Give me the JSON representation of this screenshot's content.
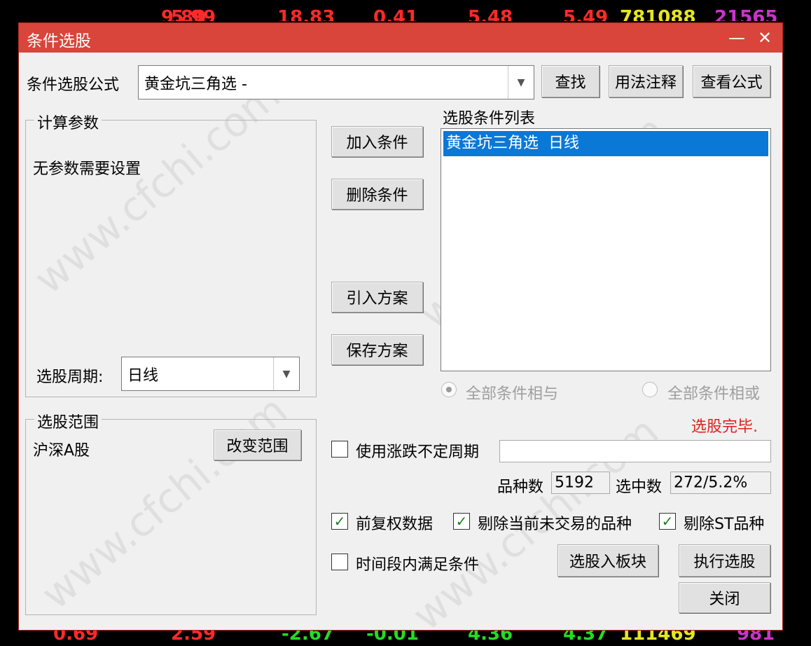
{
  "ticker_top": [
    {
      "text": "9.80",
      "color": "#ff2a2a"
    },
    {
      "text": "5.99",
      "color": "#ff2a2a"
    },
    {
      "text": "18.83",
      "color": "#ff2a2a"
    },
    {
      "text": "0.41",
      "color": "#ff2a2a"
    },
    {
      "text": "5.48",
      "color": "#ff2a2a"
    },
    {
      "text": "5.49",
      "color": "#ff2a2a"
    },
    {
      "text": "781088",
      "color": "#e6e61e"
    },
    {
      "text": "21565",
      "color": "#cc33cc"
    }
  ],
  "ticker_bottom": [
    {
      "text": "0.69",
      "color": "#ff2a2a"
    },
    {
      "text": "2.59",
      "color": "#ff2a2a"
    },
    {
      "text": "-2.67",
      "color": "#22dd22"
    },
    {
      "text": "-0.01",
      "color": "#22dd22"
    },
    {
      "text": "4.36",
      "color": "#22dd22"
    },
    {
      "text": "4.37",
      "color": "#22dd22"
    },
    {
      "text": "111469",
      "color": "#e6e61e"
    },
    {
      "text": "981",
      "color": "#cc33cc"
    }
  ],
  "window": {
    "title": "条件选股",
    "minimize_glyph": "—",
    "close_glyph": "✕"
  },
  "formula": {
    "label": "条件选股公式",
    "value": "黄金坑三角选 -",
    "find_button": "查找",
    "usage_button": "用法注释",
    "view_button": "查看公式"
  },
  "params": {
    "group_title": "计算参数",
    "message": "无参数需要设置",
    "period_label": "选股周期:",
    "period_value": "日线"
  },
  "range": {
    "group_title": "选股范围",
    "value": "沪深A股",
    "change_button": "改变范围"
  },
  "actions": {
    "add": "加入条件",
    "delete": "删除条件",
    "import": "引入方案",
    "save": "保存方案"
  },
  "conditions": {
    "title": "选股条件列表",
    "items": [
      "黄金坑三角选  日线"
    ],
    "radio_and": "全部条件相与",
    "radio_or": "全部条件相或"
  },
  "status": {
    "text": "选股完毕.",
    "color": "#e02020"
  },
  "options": {
    "undetermined_period": {
      "label": "使用涨跌不定周期",
      "checked": false,
      "value": ""
    },
    "count_label": "品种数",
    "count_value": "5192",
    "selected_label": "选中数",
    "selected_value": "272/5.2%",
    "pre_adjust": {
      "label": "前复权数据",
      "checked": true
    },
    "exclude_untraded": {
      "label": "剔除当前未交易的品种",
      "checked": true
    },
    "exclude_st": {
      "label": "剔除ST品种",
      "checked": true
    },
    "time_range": {
      "label": "时间段内满足条件",
      "checked": false
    }
  },
  "bottom_buttons": {
    "to_block": "选股入板块",
    "execute": "执行选股",
    "close": "关闭"
  },
  "watermark": "www.cfchi.com",
  "checkmark_glyph": "✓",
  "dropdown_glyph": "▼"
}
